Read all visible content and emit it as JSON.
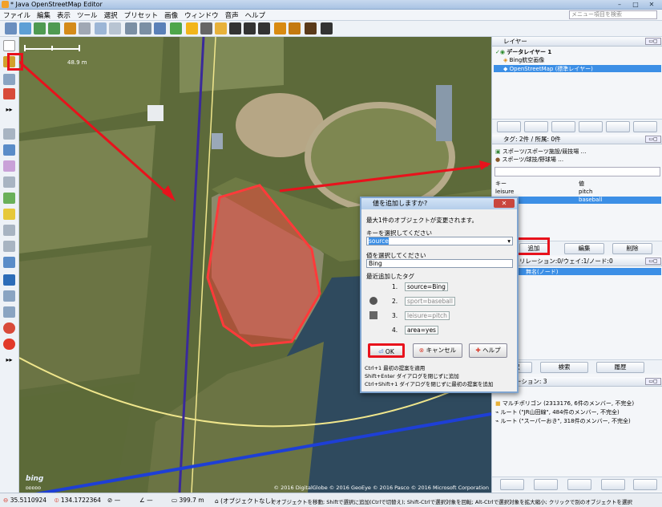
{
  "window": {
    "title": "* Java OpenStreetMap Editor",
    "controls": [
      "–",
      "□",
      "✕"
    ]
  },
  "menu": {
    "items": [
      "ファイル",
      "編集",
      "表示",
      "ツール",
      "選択",
      "プリセット",
      "画像",
      "ウィンドウ",
      "音声",
      "ヘルプ"
    ],
    "search_placeholder": "メニュー項目を検索"
  },
  "map": {
    "scale_label": "48.9 m",
    "attribution": "© 2016 DigitalGlobe © 2016 GeoEye © 2016 Pasco © 2016 Microsoft Corporation",
    "logo": "bing",
    "tiny_label": "ɒɒɒɒɒ"
  },
  "layers": {
    "header": "レイヤー",
    "items": [
      "データレイヤー 1",
      "Bing航空画像",
      "OpenStreetMap (標準レイヤー)"
    ]
  },
  "tags": {
    "header": "タグ: 2件 / 所属: 0件",
    "presets": [
      "スポーツ/スポーツ施設/競技場 …",
      "スポーツ/球技/野球場 …"
    ],
    "col_key": "キー",
    "col_value": "値",
    "rows": [
      {
        "key": "leisure",
        "value": "pitch"
      },
      {
        "key": "sport",
        "value": "baseball"
      }
    ],
    "btn_add": "追加",
    "btn_edit": "編集",
    "btn_delete": "削除"
  },
  "selection": {
    "header": "選択: リレーション:0/ウェイ:1/ノード:0",
    "item": "無名(ノード)",
    "btn_select": "選択",
    "btn_search": "検索",
    "btn_history": "履歴"
  },
  "relations": {
    "header": "リレーション: 3",
    "items": [
      "マルチポリゴン (2313176, 6件のメンバー, 不完全)",
      "ルート (\"JR山田線\", 484件のメンバー, 不完全)",
      "ルート (\"スーパーおき\", 318件のメンバー, 不完全)"
    ]
  },
  "dialog": {
    "title": "値を追加しますか?",
    "subtitle": "最大1件のオブジェクトが変更されます。",
    "key_label": "キーを選択してください",
    "key_value": "source",
    "val_label": "値を選択してください",
    "val_value": "Bing",
    "recent_label": "最近追加したタグ",
    "recent": [
      {
        "n": "1.",
        "tag": "source=Bing"
      },
      {
        "n": "2.",
        "tag": "sport=baseball"
      },
      {
        "n": "3.",
        "tag": "leisure=pitch"
      },
      {
        "n": "4.",
        "tag": "area=yes"
      }
    ],
    "ok": "OK",
    "cancel": "キャンセル",
    "help": "ヘルプ",
    "hints": [
      "Ctrl+1 最初の提案を適用",
      "Shift+Enter ダイアログを閉じずに追加",
      "Ctrl+Shift+1 ダイアログを閉じずに最初の提案を追加"
    ]
  },
  "status": {
    "lat": "35.5110924",
    "lon": "134.1722364",
    "angle": "—",
    "heading": "—",
    "dist": "399.7 m",
    "nameless": "(オブジェクトなし)",
    "hint": "でオブジェクトを移動; Shiftで選択に追加(Ctrlで切替え); Shift-Ctrlで選択対象を回転; Alt-Ctrlで選択対象を拡大縮小; クリックで別のオブジェクトを選択"
  },
  "colors": {
    "selection": "#3c8fe6",
    "highlight": "#e8121c",
    "area": "#ff3a3a"
  }
}
